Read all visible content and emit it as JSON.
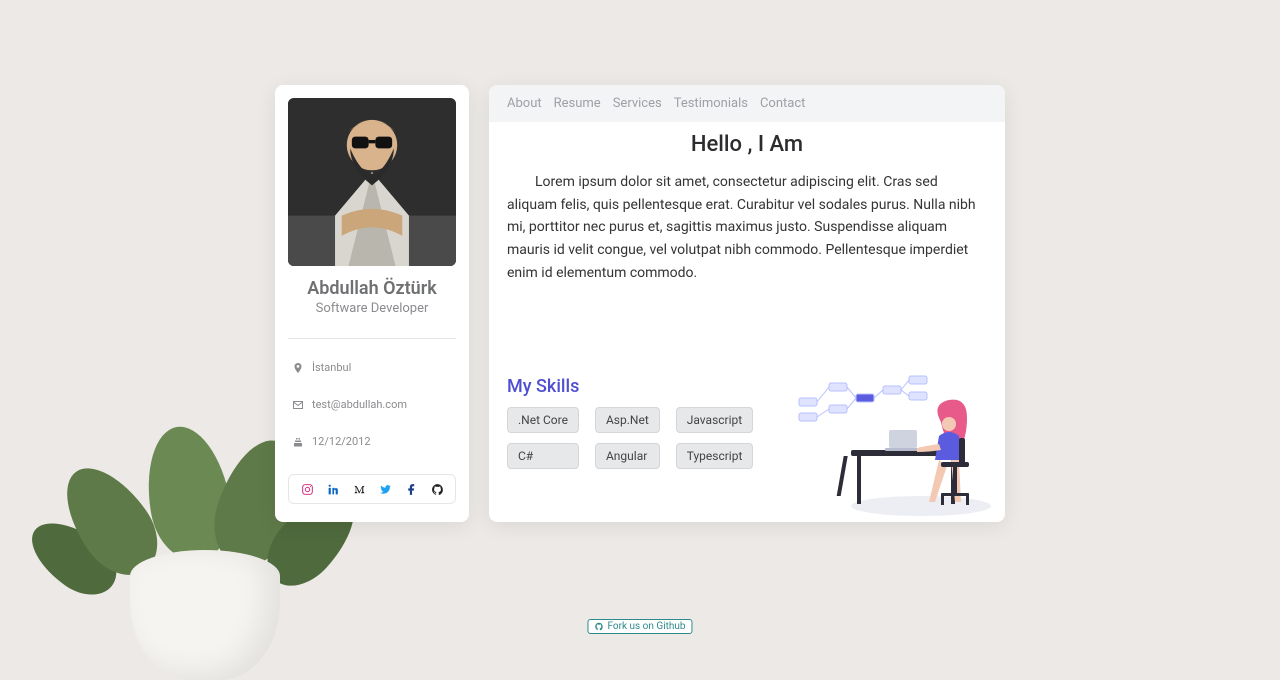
{
  "profile": {
    "name": "Abdullah Öztürk",
    "role": "Software Developer",
    "location": "İstanbul",
    "email": "test@abdullah.com",
    "date": "12/12/2012"
  },
  "social": {
    "instagram": "instagram-icon",
    "linkedin": "linkedin-icon",
    "medium": "medium-icon",
    "twitter": "twitter-icon",
    "facebook": "facebook-icon",
    "github": "github-icon"
  },
  "nav": {
    "about": "About",
    "resume": "Resume",
    "services": "Services",
    "testimonials": "Testimonials",
    "contact": "Contact"
  },
  "main": {
    "hello": "Hello , I Am",
    "bio": "Lorem ipsum dolor sit amet, consectetur adipiscing elit. Cras sed aliquam felis, quis pellentesque erat. Curabitur vel sodales purus. Nulla nibh mi, porttitor nec purus et, sagittis maximus justo. Suspendisse aliquam mauris id velit congue, vel volutpat nibh commodo. Pellentesque imperdiet enim id elementum commodo.",
    "skills_title": "My Skills",
    "skills": {
      "dotnetcore": ".Net Core",
      "aspnet": "Asp.Net",
      "javascript": "Javascript",
      "csharp": "C#",
      "angular": "Angular",
      "typescript": "Typescript"
    }
  },
  "footer": {
    "fork": "Fork us on Github"
  },
  "colors": {
    "accent": "#4f4fd1",
    "twitter": "#1da1f2",
    "instagram": "#d53f8c",
    "facebook": "#1c3d8a",
    "github": "#222",
    "linkedin": "#0a66c2",
    "medium": "#222"
  }
}
